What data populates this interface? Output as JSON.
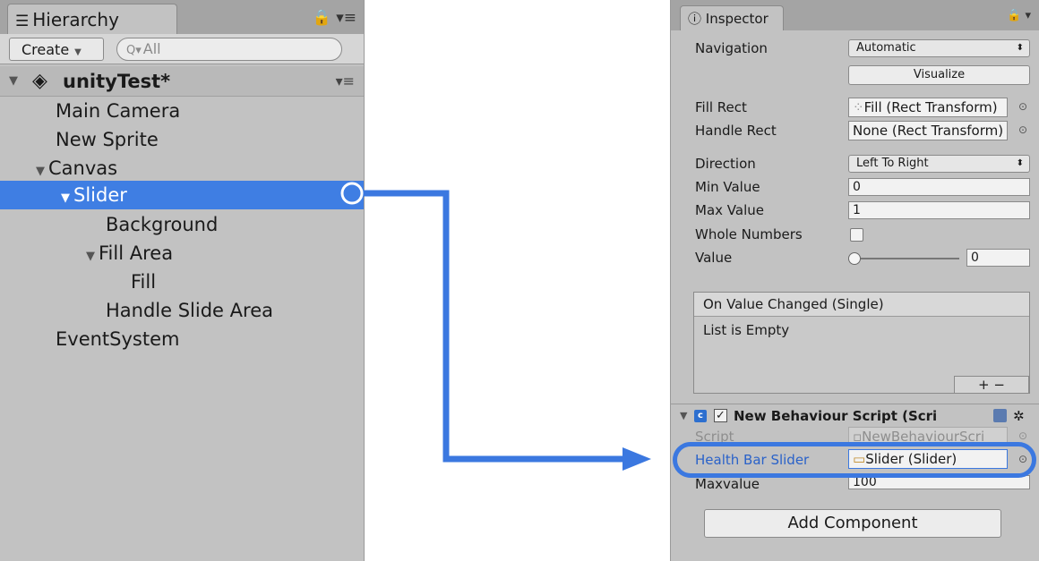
{
  "hierarchy": {
    "tab_icon": "list-icon",
    "tab_label": "Hierarchy",
    "tab_tools": "🔒 ▾≡",
    "create_label": "Create",
    "search_prefix": "Q▾",
    "search_placeholder": "All",
    "scene": {
      "name": "unityTest*",
      "arrow": "▼",
      "menu": "▾≡"
    },
    "items": [
      {
        "label": "Main Camera",
        "arrow": ""
      },
      {
        "label": "New Sprite",
        "arrow": ""
      },
      {
        "label": "Canvas",
        "arrow": "▼"
      },
      {
        "label": "Slider",
        "arrow": "▼",
        "selected": true
      },
      {
        "label": "Background",
        "arrow": ""
      },
      {
        "label": "Fill Area",
        "arrow": "▼"
      },
      {
        "label": "Fill",
        "arrow": ""
      },
      {
        "label": "Handle Slide Area",
        "arrow": ""
      },
      {
        "label": "EventSystem",
        "arrow": ""
      }
    ]
  },
  "inspector": {
    "tab_label": "Inspector",
    "tab_tools": "🔒 ▾",
    "navigation": {
      "label": "Navigation",
      "value": "Automatic"
    },
    "visualize_label": "Visualize",
    "fill_rect": {
      "label": "Fill Rect",
      "value": "Fill (Rect Transform)"
    },
    "handle_rect": {
      "label": "Handle Rect",
      "value": "None (Rect Transform)"
    },
    "direction": {
      "label": "Direction",
      "value": "Left To Right"
    },
    "min_value": {
      "label": "Min Value",
      "value": "0"
    },
    "max_value": {
      "label": "Max Value",
      "value": "1"
    },
    "whole_numbers": {
      "label": "Whole Numbers",
      "checked": false
    },
    "value": {
      "label": "Value",
      "value": "0"
    },
    "on_value_changed": {
      "header": "On Value Changed (Single)",
      "empty_text": "List is Empty",
      "buttons": "+   −"
    },
    "component": {
      "title": "New Behaviour Script (Scri",
      "script": {
        "label": "Script",
        "value": "NewBehaviourScri"
      },
      "health_bar_slider": {
        "label": "Health Bar Slider",
        "value": "Slider (Slider)"
      },
      "max_value": {
        "label": "Maxvalue",
        "value": "100"
      }
    },
    "add_component_label": "Add Component"
  },
  "colors": {
    "selection": "#3f7ee3",
    "highlight": "#3b78e0",
    "panel": "#c2c2c2"
  }
}
